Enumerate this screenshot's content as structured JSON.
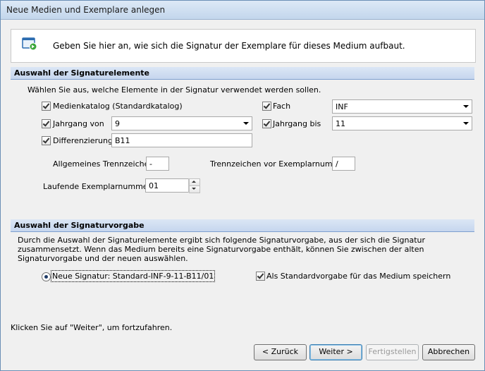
{
  "window": {
    "title": "Neue Medien und Exemplare anlegen"
  },
  "info": {
    "icon": "window-go-icon",
    "text": "Geben Sie hier an, wie sich die Signatur der Exemplare für dieses Medium aufbaut."
  },
  "section1": {
    "title": "Auswahl der Signaturelemente",
    "instruction": "Wählen Sie aus, welche Elemente in der Signatur verwendet werden sollen.",
    "medienkatalog": {
      "label": "Medienkatalog (Standardkatalog)",
      "checked": true
    },
    "fach": {
      "label": "Fach",
      "checked": true,
      "value": "INF"
    },
    "jahrgang_von": {
      "label": "Jahrgang von",
      "checked": true,
      "value": "9"
    },
    "jahrgang_bis": {
      "label": "Jahrgang bis",
      "checked": true,
      "value": "11"
    },
    "differenzierung": {
      "label": "Differenzierung",
      "checked": true,
      "value": "B11"
    },
    "trennzeichen": {
      "label": "Allgemeines Trennzeichen",
      "value": "-"
    },
    "trennzeichen_exemplar": {
      "label": "Trennzeichen vor Exemplarnummer",
      "value": "/"
    },
    "laufende_nummer": {
      "label": "Laufende Exemplarnummer",
      "value": "01"
    }
  },
  "section2": {
    "title": "Auswahl der Signaturvorgabe",
    "description": "Durch die Auswahl der Signaturelemente ergibt sich folgende Signaturvorgabe, aus der sich die Signatur zusammensetzt. Wenn das Medium bereits eine Signaturvorgabe enthält, können Sie zwischen der alten Signaturvorgabe und der neuen auswählen.",
    "radio_label": "Neue Signatur: Standard-INF-9-11-B11/01",
    "default_label": "Als Standardvorgabe für das Medium speichern",
    "default_checked": true
  },
  "footer": {
    "hint": "Klicken Sie auf \"Weiter\", um fortzufahren.",
    "back": "< Zurück",
    "next": "Weiter >",
    "finish": "Fertigstellen",
    "cancel": "Abbrechen"
  }
}
